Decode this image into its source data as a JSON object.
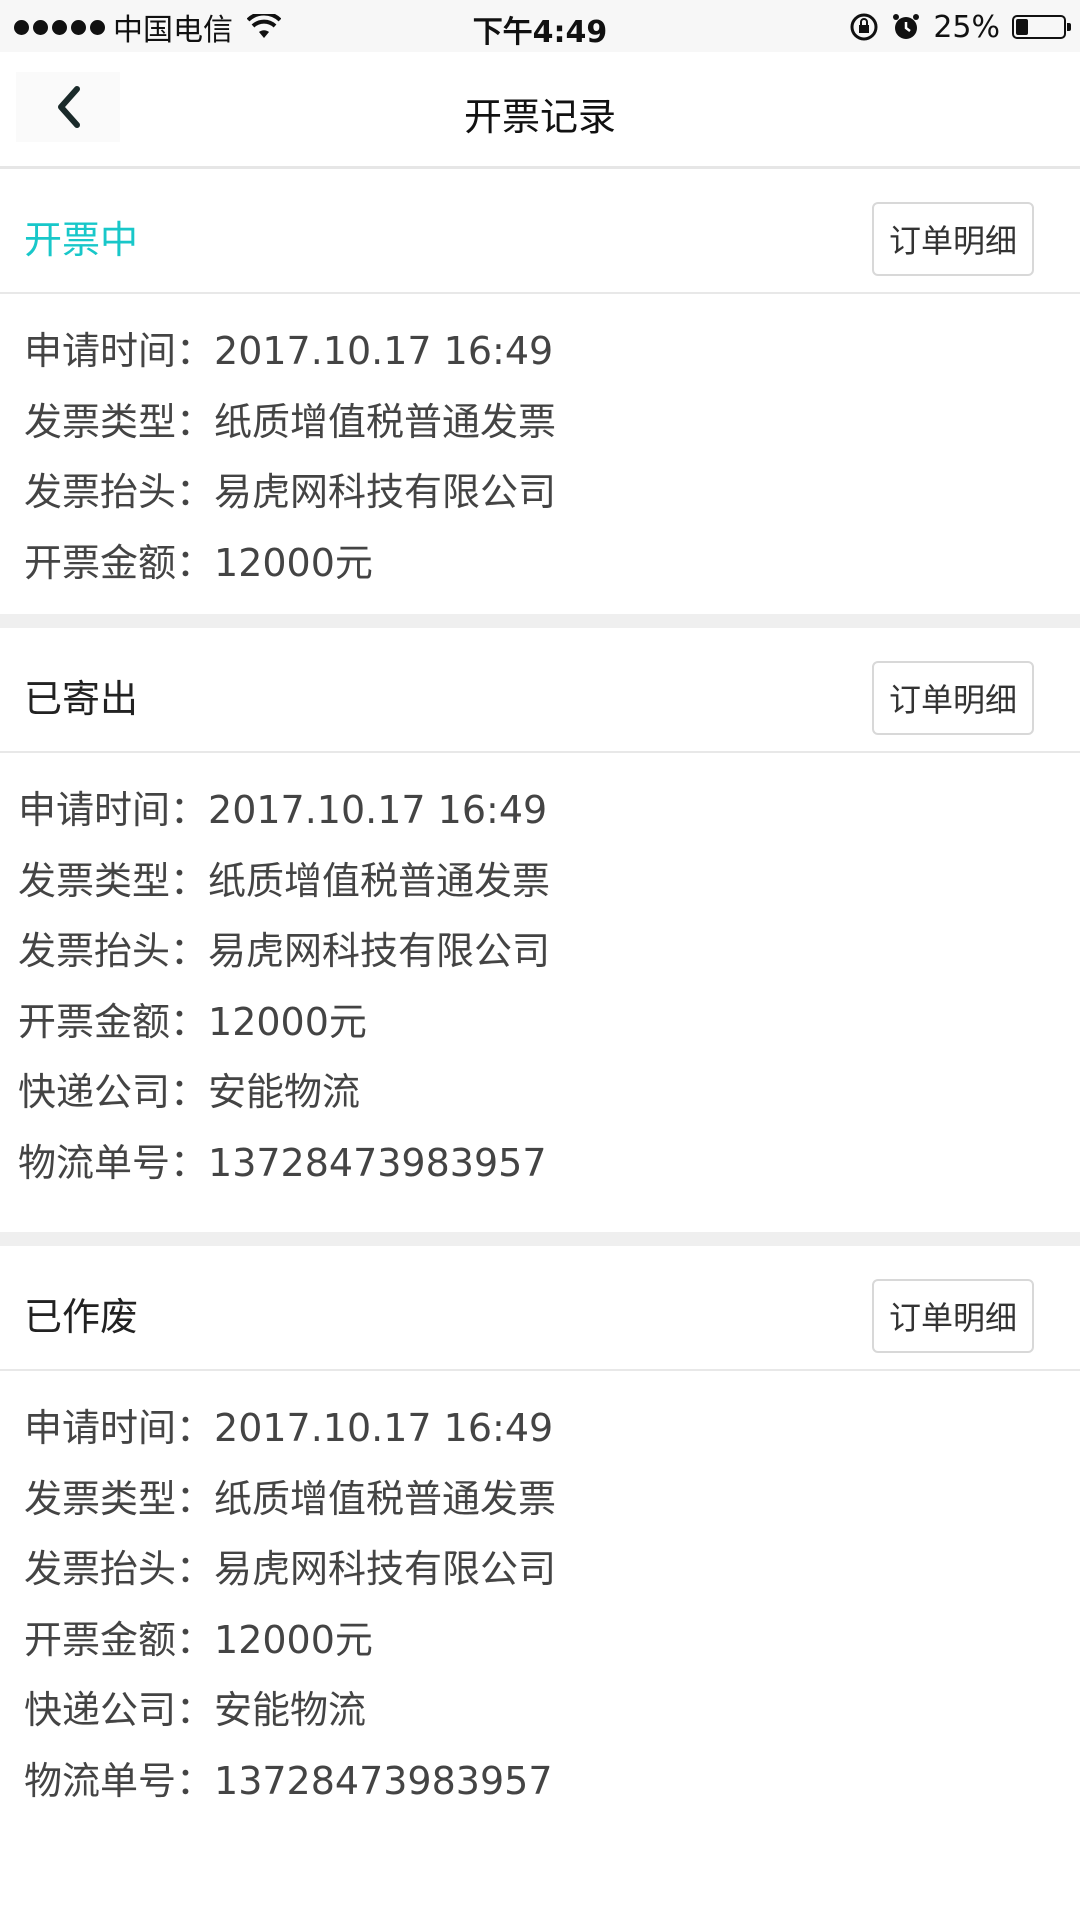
{
  "status_bar": {
    "carrier": "中国电信",
    "time": "下午4:49",
    "battery_percent": "25%",
    "battery_level": 0.25
  },
  "nav": {
    "title": "开票记录"
  },
  "cards": [
    {
      "status": "开票中",
      "status_color": "#18c7c9",
      "button": "订单明细",
      "rows": [
        {
          "label": "申请时间：",
          "value": "2017.10.17 16:49"
        },
        {
          "label": "发票类型：",
          "value": "纸质增值税普通发票"
        },
        {
          "label": "发票抬头：",
          "value": "易虎网科技有限公司"
        },
        {
          "label": "开票金额：",
          "value": "12000元"
        }
      ]
    },
    {
      "status": "已寄出",
      "button": "订单明细",
      "rows": [
        {
          "label": "申请时间：",
          "value": "2017.10.17 16:49"
        },
        {
          "label": "发票类型：",
          "value": "纸质增值税普通发票"
        },
        {
          "label": "发票抬头：",
          "value": "易虎网科技有限公司"
        },
        {
          "label": "开票金额：",
          "value": "12000元"
        },
        {
          "label": "快递公司：",
          "value": "安能物流"
        },
        {
          "label": "物流单号：",
          "value": "13728473983957"
        }
      ]
    },
    {
      "status": "已作废",
      "button": "订单明细",
      "rows": [
        {
          "label": "申请时间：",
          "value": "2017.10.17 16:49"
        },
        {
          "label": "发票类型：",
          "value": "纸质增值税普通发票"
        },
        {
          "label": "发票抬头：",
          "value": "易虎网科技有限公司"
        },
        {
          "label": "开票金额：",
          "value": "12000元"
        },
        {
          "label": "快递公司：",
          "value": "安能物流"
        },
        {
          "label": "物流单号：",
          "value": "13728473983957"
        }
      ]
    }
  ]
}
